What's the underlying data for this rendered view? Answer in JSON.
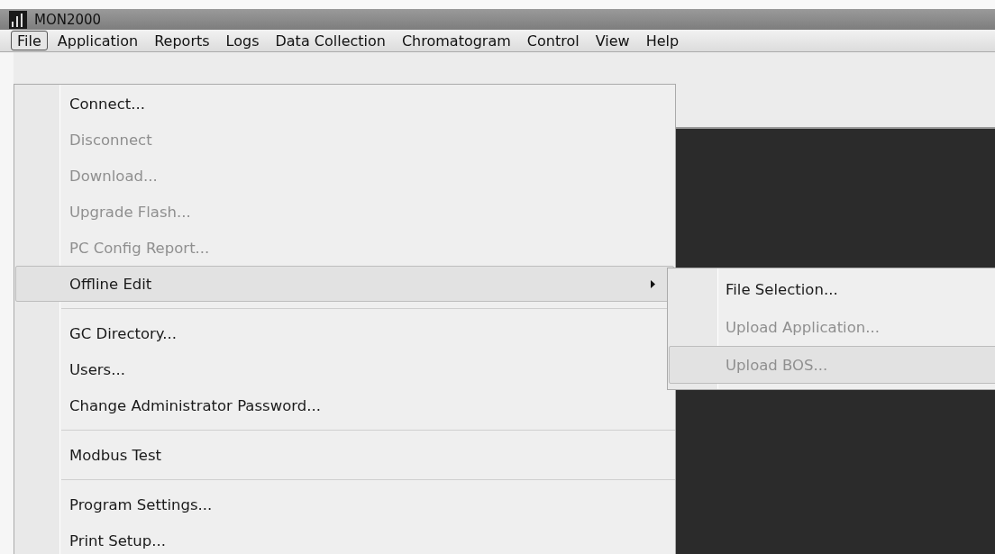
{
  "window": {
    "title": "MON2000"
  },
  "menu_bar": [
    {
      "label": "File",
      "selected": true
    },
    {
      "label": "Application",
      "selected": false
    },
    {
      "label": "Reports",
      "selected": false
    },
    {
      "label": "Logs",
      "selected": false
    },
    {
      "label": "Data Collection",
      "selected": false
    },
    {
      "label": "Chromatogram",
      "selected": false
    },
    {
      "label": "Control",
      "selected": false
    },
    {
      "label": "View",
      "selected": false
    },
    {
      "label": "Help",
      "selected": false
    }
  ],
  "file_menu": [
    {
      "kind": "item",
      "label": "Connect...",
      "disabled": false,
      "selected": false,
      "submenu": false
    },
    {
      "kind": "item",
      "label": "Disconnect",
      "disabled": true,
      "selected": false,
      "submenu": false
    },
    {
      "kind": "item",
      "label": "Download...",
      "disabled": true,
      "selected": false,
      "submenu": false
    },
    {
      "kind": "item",
      "label": "Upgrade Flash...",
      "disabled": true,
      "selected": false,
      "submenu": false
    },
    {
      "kind": "item",
      "label": "PC Config Report...",
      "disabled": true,
      "selected": false,
      "submenu": false
    },
    {
      "kind": "item",
      "label": "Offline Edit",
      "disabled": false,
      "selected": true,
      "submenu": true
    },
    {
      "kind": "separator"
    },
    {
      "kind": "item",
      "label": "GC Directory...",
      "disabled": false,
      "selected": false,
      "submenu": false
    },
    {
      "kind": "item",
      "label": "Users...",
      "disabled": false,
      "selected": false,
      "submenu": false
    },
    {
      "kind": "item",
      "label": "Change Administrator Password...",
      "disabled": false,
      "selected": false,
      "submenu": false
    },
    {
      "kind": "separator"
    },
    {
      "kind": "item",
      "label": "Modbus Test",
      "disabled": false,
      "selected": false,
      "submenu": false
    },
    {
      "kind": "separator"
    },
    {
      "kind": "item",
      "label": "Program Settings...",
      "disabled": false,
      "selected": false,
      "submenu": false
    },
    {
      "kind": "item",
      "label": "Print Setup...",
      "disabled": false,
      "selected": false,
      "submenu": false
    }
  ],
  "offline_edit_submenu": [
    {
      "label": "File Selection...",
      "disabled": false,
      "selected": false
    },
    {
      "label": "Upload Application...",
      "disabled": true,
      "selected": false
    },
    {
      "label": "Upload BOS...",
      "disabled": true,
      "selected": true
    }
  ]
}
